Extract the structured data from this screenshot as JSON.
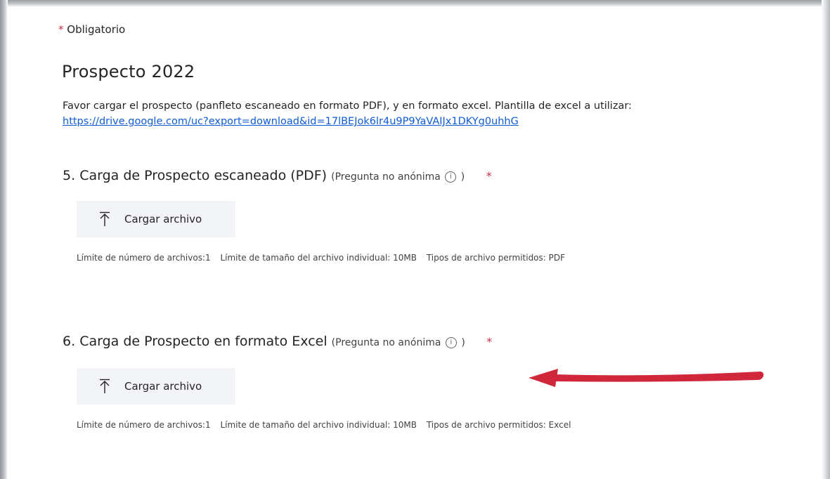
{
  "form": {
    "required_asterisk": "*",
    "required_label": "Obligatorio",
    "title": "Prospecto 2022",
    "description": "Favor cargar el prospecto (panfleto escaneado en formato PDF), y en formato excel. Plantilla de excel a utilizar:",
    "template_link": "https://drive.google.com/uc?export=download&id=17lBEJok6lr4u9P9YaVAIJx1DKYg0uhhG"
  },
  "questions": [
    {
      "number": "5.",
      "title": "Carga de Prospecto escaneado (PDF)",
      "note_open": "(Pregunta no anónima",
      "info_symbol": "i",
      "note_close": ")",
      "required_asterisk": "*",
      "upload_label": "Cargar archivo",
      "limits": {
        "file_count": "Límite de número de archivos:1",
        "file_size": "Límite de tamaño del archivo individual: 10MB",
        "file_types": "Tipos de archivo permitidos: PDF"
      }
    },
    {
      "number": "6.",
      "title": "Carga de Prospecto en formato Excel",
      "note_open": "(Pregunta no anónima",
      "info_symbol": "i",
      "note_close": ")",
      "required_asterisk": "*",
      "upload_label": "Cargar archivo",
      "limits": {
        "file_count": "Límite de número de archivos:1",
        "file_size": "Límite de tamaño del archivo individual: 10MB",
        "file_types": "Tipos de archivo permitidos: Excel"
      }
    }
  ],
  "icons": {
    "upload": "upload-arrow-icon",
    "info": "info-icon",
    "annotation": "red-arrow-annotation"
  },
  "colors": {
    "required": "#c4314b",
    "link": "#0f5bd6",
    "button_bg": "#f3f4f7",
    "annotation_arrow": "#d0283a"
  }
}
